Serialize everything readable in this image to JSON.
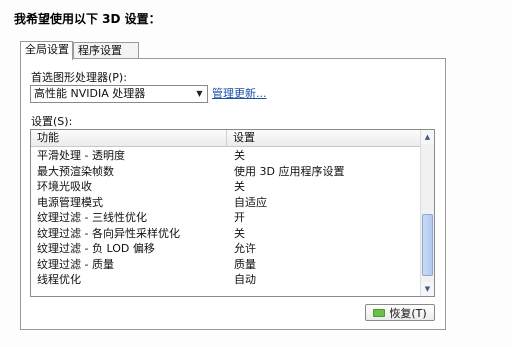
{
  "heading": "我希望使用以下 3D 设置：",
  "tabs": [
    {
      "label": "全局设置",
      "active": true
    },
    {
      "label": "程序设置",
      "active": false
    }
  ],
  "preferred_gpu": {
    "label": "首选图形处理器(P):",
    "value": "高性能 NVIDIA 处理器",
    "manage_link": "管理更新..."
  },
  "settings": {
    "label": "设置(S):",
    "columns": [
      "功能",
      "设置"
    ],
    "rows": [
      {
        "feature": "平滑处理 - 透明度",
        "value": "关"
      },
      {
        "feature": "最大预渲染帧数",
        "value": "使用 3D 应用程序设置"
      },
      {
        "feature": "环境光吸收",
        "value": "关"
      },
      {
        "feature": "电源管理模式",
        "value": "自适应"
      },
      {
        "feature": "纹理过滤 - 三线性优化",
        "value": "开"
      },
      {
        "feature": "纹理过滤 - 各向异性采样优化",
        "value": "关"
      },
      {
        "feature": "纹理过滤 - 负 LOD 偏移",
        "value": "允许"
      },
      {
        "feature": "纹理过滤 - 质量",
        "value": "质量"
      },
      {
        "feature": "线程优化",
        "value": "自动"
      }
    ]
  },
  "restore_button": "恢复(T)",
  "colors": {
    "link": "#1a4fa3",
    "scroll_thumb": "#b5c9ee",
    "button_icon": "#6cc04a"
  }
}
